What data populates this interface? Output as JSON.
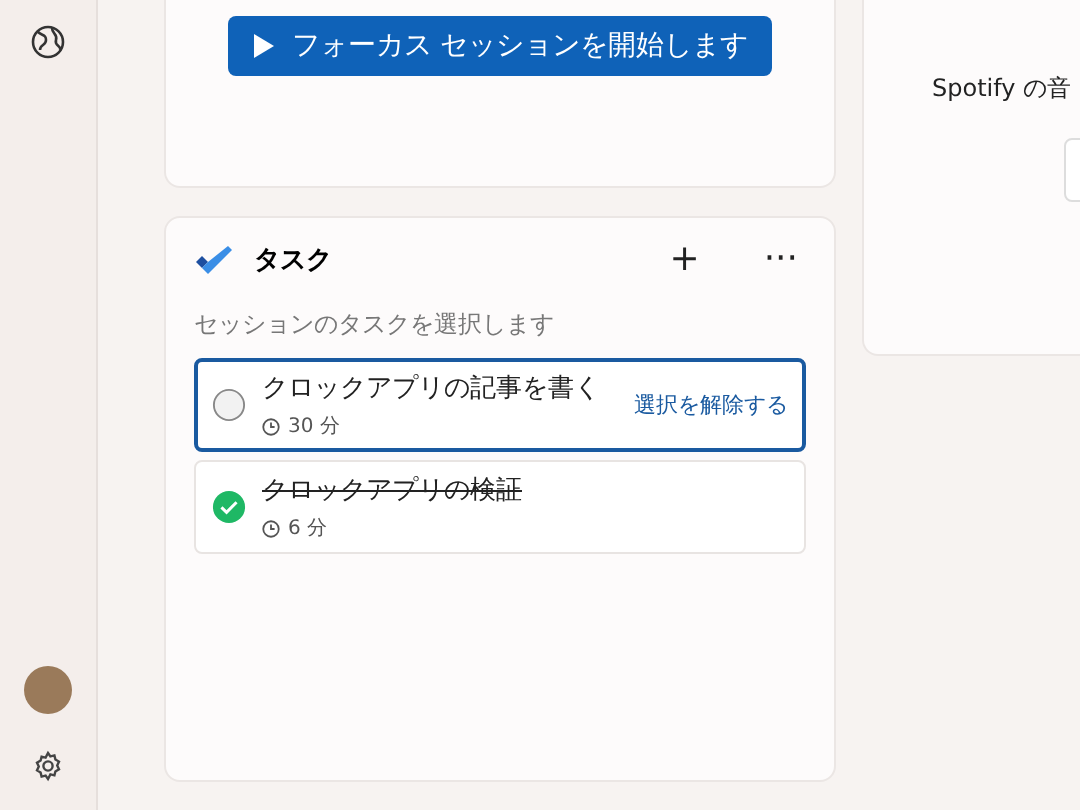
{
  "focus": {
    "start_button": "フォーカス セッションを開始します"
  },
  "tasks": {
    "title": "タスク",
    "add": "+",
    "more": "···",
    "hint": "セッションのタスクを選択します",
    "items": [
      {
        "title": "クロックアプリの記事を書く",
        "duration": "30 分",
        "selected": true,
        "completed": false,
        "action": "選択を解除する"
      },
      {
        "title": "クロックアプリの検証",
        "duration": "6 分",
        "selected": false,
        "completed": true
      }
    ]
  },
  "music": {
    "text": "Spotify の音"
  }
}
